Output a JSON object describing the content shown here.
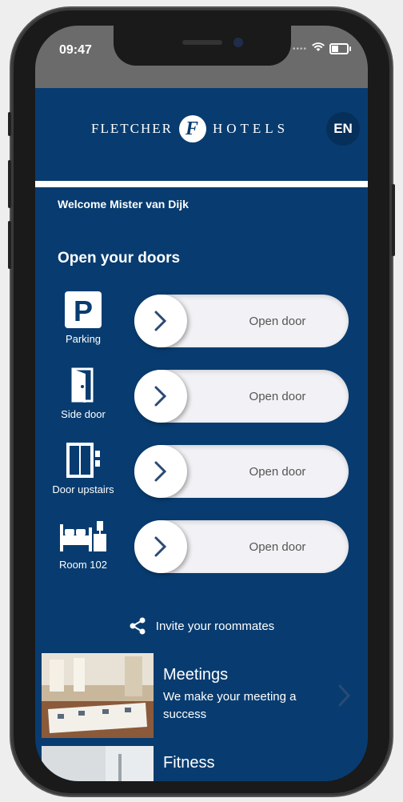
{
  "status": {
    "time": "09:47"
  },
  "header": {
    "brand_left": "FLETCHER",
    "brand_logo": "F",
    "brand_right": "HOTELS",
    "language": "EN"
  },
  "welcome": "Welcome Mister van Dijk",
  "doors": {
    "title": "Open your doors",
    "items": [
      {
        "label": "Parking",
        "icon": "parking-icon",
        "action": "Open door"
      },
      {
        "label": "Side door",
        "icon": "door-icon",
        "action": "Open door"
      },
      {
        "label": "Door upstairs",
        "icon": "elevator-icon",
        "action": "Open door"
      },
      {
        "label": "Room 102",
        "icon": "bed-icon",
        "action": "Open door"
      }
    ]
  },
  "invite": {
    "label": "Invite your roommates",
    "icon": "share-icon"
  },
  "promos": [
    {
      "title": "Meetings",
      "subtitle": "We make your meeting a success"
    },
    {
      "title": "Fitness",
      "subtitle": ""
    }
  ],
  "colors": {
    "primary": "#083c70",
    "slider": "#f2f2f6",
    "chevron": "#2b4a73"
  }
}
